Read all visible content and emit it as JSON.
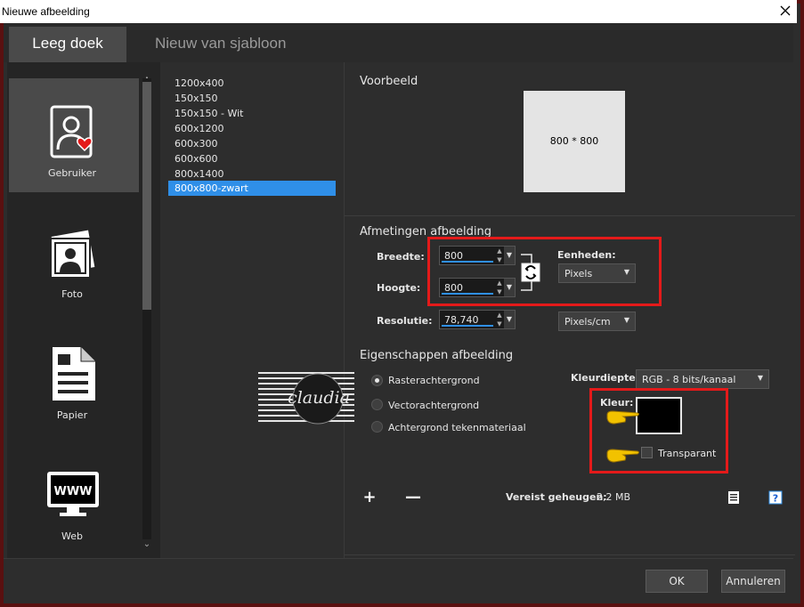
{
  "window": {
    "title": "Nieuwe afbeelding"
  },
  "tabs": [
    {
      "label": "Leeg doek",
      "active": true
    },
    {
      "label": "Nieuw van sjabloon",
      "active": false
    }
  ],
  "categories": [
    {
      "label": "Gebruiker",
      "icon": "user-heart-icon",
      "selected": true
    },
    {
      "label": "Foto",
      "icon": "photo-icon",
      "selected": false
    },
    {
      "label": "Papier",
      "icon": "paper-icon",
      "selected": false
    },
    {
      "label": "Web",
      "icon": "web-monitor-icon",
      "selected": false
    }
  ],
  "templates": [
    {
      "label": "1200x400",
      "selected": false
    },
    {
      "label": "150x150",
      "selected": false
    },
    {
      "label": "150x150 - Wit",
      "selected": false
    },
    {
      "label": "600x1200",
      "selected": false
    },
    {
      "label": "600x300",
      "selected": false
    },
    {
      "label": "600x600",
      "selected": false
    },
    {
      "label": "800x1400",
      "selected": false
    },
    {
      "label": "800x800-zwart",
      "selected": true
    }
  ],
  "preview": {
    "title": "Voorbeeld",
    "text": "800 * 800"
  },
  "dimensions": {
    "title": "Afmetingen afbeelding",
    "width_label": "Breedte:",
    "width_value": "800",
    "height_label": "Hoogte:",
    "height_value": "800",
    "units_label": "Eenheden:",
    "units_value": "Pixels",
    "resolution_label": "Resolutie:",
    "resolution_value": "78,740",
    "resolution_unit": "Pixels/cm"
  },
  "properties": {
    "title": "Eigenschappen afbeelding",
    "options": [
      {
        "label": "Rasterachtergrond",
        "checked": true
      },
      {
        "label": "Vectorachtergrond",
        "checked": false
      },
      {
        "label": "Achtergrond tekenmateriaal",
        "checked": false
      }
    ],
    "depth_label": "Kleurdiepte:",
    "depth_value": "RGB - 8 bits/kanaal",
    "color_label": "Kleur:",
    "color_value": "#000000",
    "transparent_label": "Transparant",
    "transparent_checked": false
  },
  "memory": {
    "label": "Vereist geheugen:",
    "value": "2,2 MB"
  },
  "buttons": {
    "ok": "OK",
    "cancel": "Annuleren"
  },
  "watermark": {
    "text": "claudia"
  },
  "colors": {
    "accent": "#2f8fe8",
    "highlight": "#e41a1a",
    "frame": "#5a1010"
  }
}
